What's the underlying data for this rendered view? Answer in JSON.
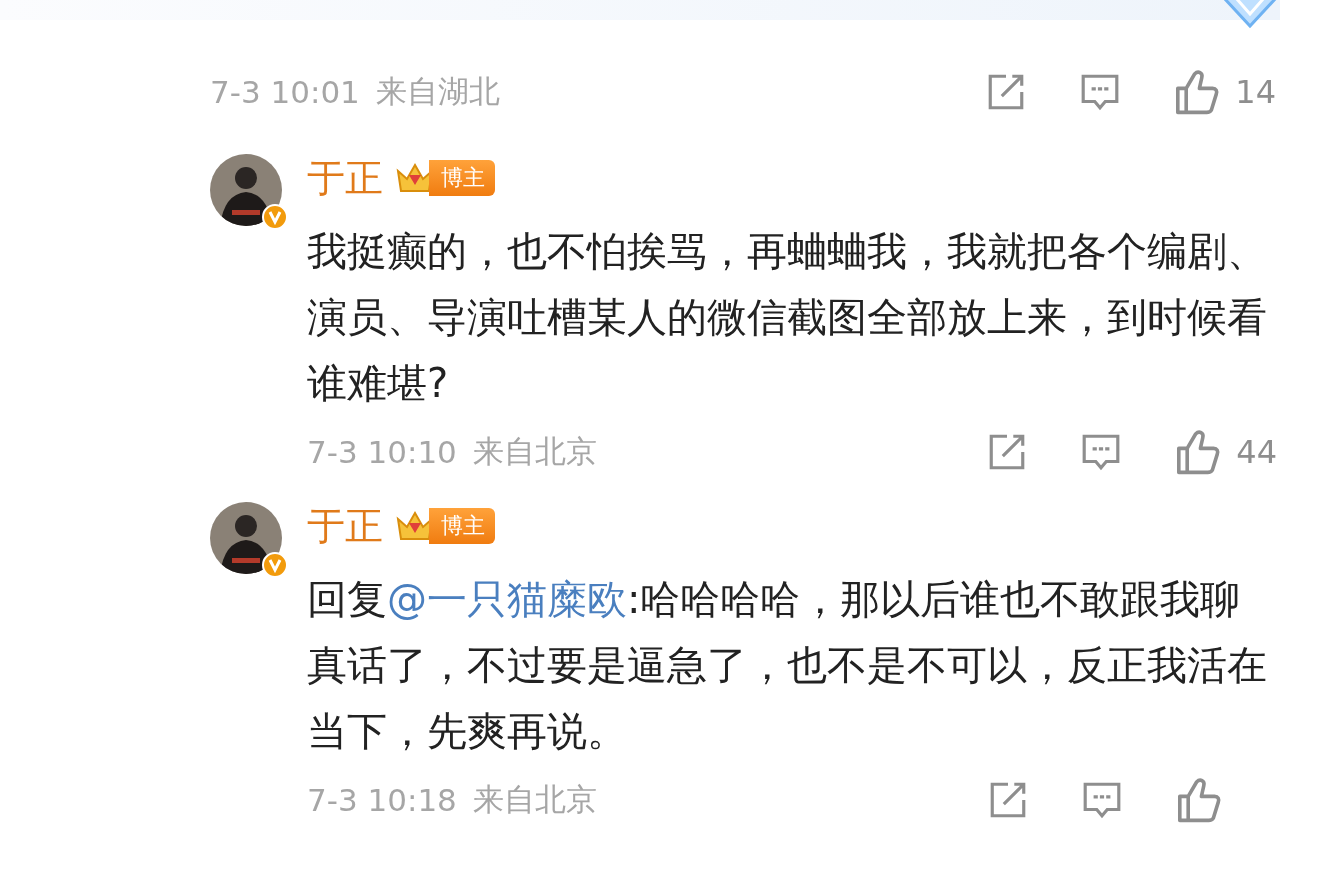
{
  "parent": {
    "meta": {
      "time": "7-3 10:01",
      "location": "来自湖北",
      "likes": "14"
    }
  },
  "replies": [
    {
      "name": "于正",
      "badge": "博主",
      "verified": true,
      "text": "我挺癫的，也不怕挨骂，再蛐蛐我，我就把各个编剧、演员、导演吐槽某人的微信截图全部放上来，到时候看谁难堪?",
      "meta": {
        "time": "7-3 10:10",
        "location": "来自北京",
        "likes": "44"
      }
    },
    {
      "name": "于正",
      "badge": "博主",
      "verified": true,
      "reply_prefix": "回复",
      "mention": "@一只猫糜欧",
      "text": ":哈哈哈哈，那以后谁也不敢跟我聊真话了，不过要是逼急了，也不是不可以，反正我活在当下，先爽再说。",
      "meta": {
        "time": "7-3 10:18",
        "location": "来自北京"
      }
    }
  ]
}
